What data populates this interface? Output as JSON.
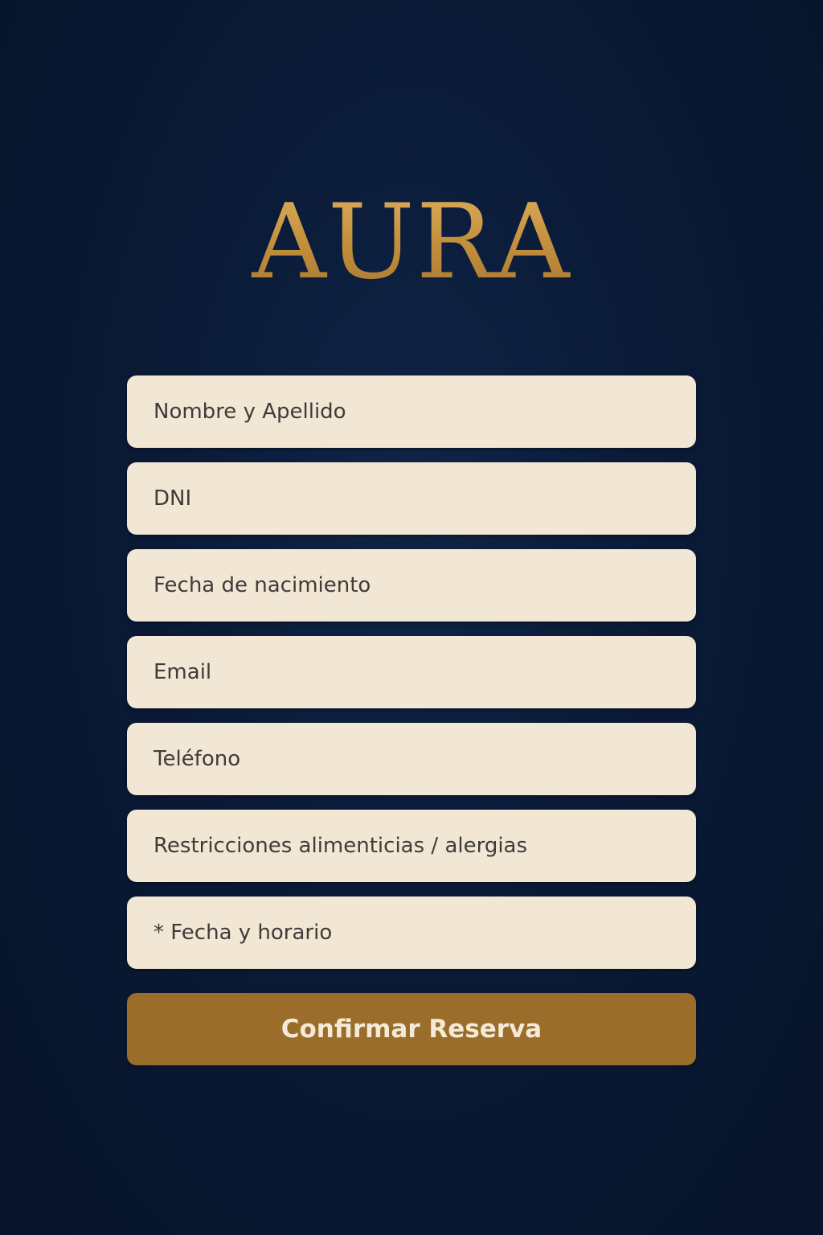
{
  "brand": {
    "logo_text": "AURA"
  },
  "form": {
    "fields": [
      {
        "placeholder": "Nombre y Apellido"
      },
      {
        "placeholder": "DNI"
      },
      {
        "placeholder": "Fecha de nacimiento"
      },
      {
        "placeholder": "Email"
      },
      {
        "placeholder": "Teléfono"
      },
      {
        "placeholder": "Restricciones alimenticias / alergias"
      },
      {
        "placeholder": "* Fecha y horario"
      }
    ],
    "submit_label": "Confirmar Reserva"
  },
  "colors": {
    "background": "#0a1a36",
    "accent_gold": "#c4923f",
    "field_background": "#f2e6d5",
    "button_background": "#9b6d2b"
  }
}
